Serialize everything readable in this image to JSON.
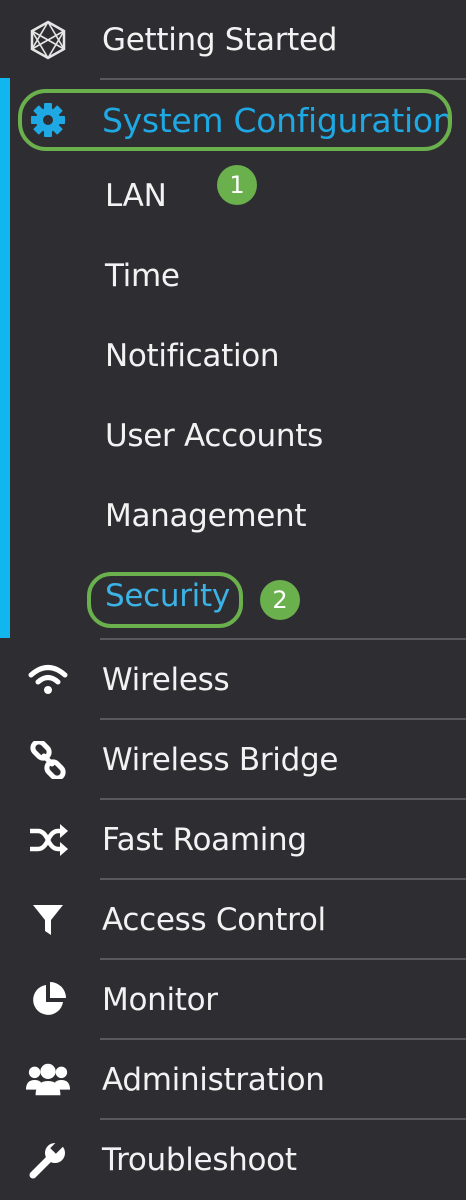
{
  "nav": {
    "getting_started": "Getting Started",
    "system_configuration": "System Configuration",
    "sub_items": {
      "lan": "LAN",
      "time": "Time",
      "notification": "Notification",
      "user_accounts": "User Accounts",
      "management": "Management",
      "security": "Security"
    },
    "wireless": "Wireless",
    "wireless_bridge": "Wireless Bridge",
    "fast_roaming": "Fast Roaming",
    "access_control": "Access Control",
    "monitor": "Monitor",
    "administration": "Administration",
    "troubleshoot": "Troubleshoot"
  },
  "annotations": {
    "step1": "1",
    "step2": "2"
  },
  "colors": {
    "background": "#2e2e32",
    "accent_blue": "#12b6ef",
    "callout_green": "#6ab04c",
    "text": "#f2f2f2"
  },
  "icons": {
    "getting_started": "hexagon-network-icon",
    "system_configuration": "gear-icon",
    "wireless": "wifi-icon",
    "wireless_bridge": "chain-link-icon",
    "fast_roaming": "shuffle-icon",
    "access_control": "filter-icon",
    "monitor": "pie-chart-icon",
    "administration": "users-icon",
    "troubleshoot": "wrench-icon"
  }
}
